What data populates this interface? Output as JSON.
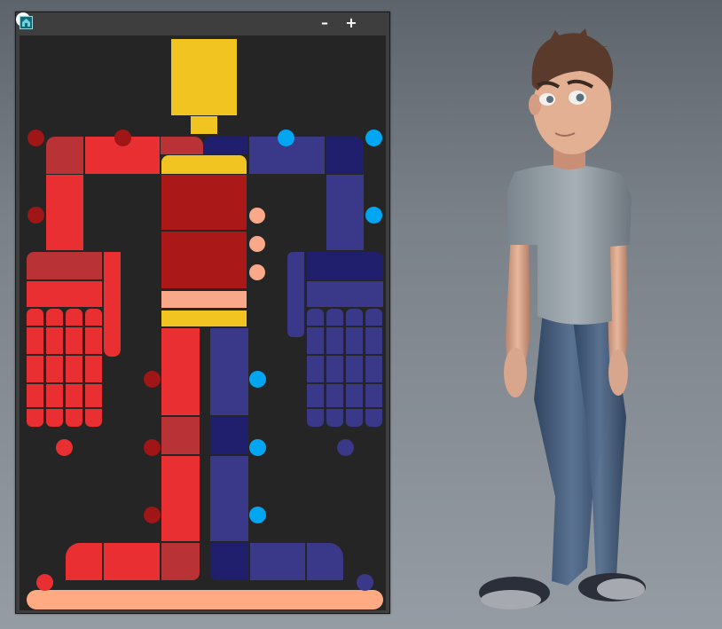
{
  "window": {
    "minimize_label": "–",
    "maximize_label": "+",
    "close_label": "✕"
  },
  "icons": {
    "app": "picker-app-icon",
    "minimize": "minimize-icon",
    "maximize": "plus-icon",
    "close": "close-circle-icon"
  },
  "colors": {
    "window_bg": "#3e3e3e",
    "canvas_bg": "#252525",
    "head": "#f1c421",
    "spine": "#ab1818",
    "left_fk": "#ea2f32",
    "left_dark": "#b83236",
    "right_fk": "#393889",
    "right_dark": "#201f6d",
    "ik_left": "#a01516",
    "ik_right": "#00a6f1",
    "skin": "#f9a88a",
    "root_bar": "#ffaa82"
  },
  "picker": {
    "sections": [
      "head",
      "neck",
      "spine",
      "hips",
      "left-arm",
      "right-arm",
      "left-hand",
      "right-hand",
      "left-leg",
      "right-leg",
      "root"
    ],
    "finger_count_per_hand": 4
  },
  "viewport": {
    "background": "maya-gradient",
    "character": "cartoon-boy-tshirt-jeans"
  }
}
